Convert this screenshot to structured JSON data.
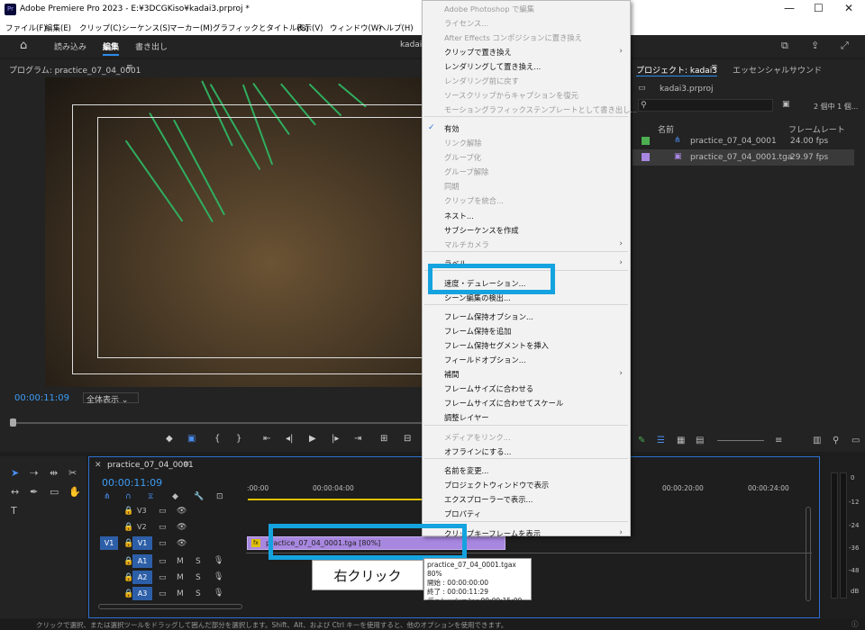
{
  "titlebar": {
    "title": "Adobe Premiere Pro 2023 - E:¥3DCGKiso¥kadai3.prproj *"
  },
  "menubar": {
    "items": [
      "ファイル(F)",
      "編集(E)",
      "クリップ(C)",
      "シーケンス(S)",
      "マーカー(M)",
      "グラフィックとタイトル(G)",
      "表示(V)",
      "ウィンドウ(W)",
      "ヘルプ(H)"
    ]
  },
  "workspaces": {
    "import": "読み込み",
    "edit": "編集",
    "export": "書き出し",
    "center": "kadai"
  },
  "program": {
    "header": "プログラム: practice_07_04_0001",
    "timecode": "00:00:11:09",
    "zoom": "全体表示"
  },
  "project": {
    "tab1": "プロジェクト: kadai3",
    "tab2": "エッセンシャルサウンド",
    "file": "kadai3.prproj",
    "count": "2 個中 1 個...",
    "col_name": "名前",
    "col_fps": "フレームレート",
    "rows": [
      {
        "name": "practice_07_04_0001",
        "fps": "24.00 fps",
        "color": "#4caf50"
      },
      {
        "name": "practice_07_04_0001.tga",
        "fps": "29.97 fps",
        "color": "#a887e0"
      }
    ]
  },
  "timeline": {
    "tab": "practice_07_04_0001",
    "timecode": "00:00:11:09",
    "ruler": [
      ":00:00",
      "00:00:04:00",
      "00:00:20:00",
      "00:00:24:00"
    ],
    "tracks": [
      "V3",
      "V2",
      "V1",
      "A1",
      "A2",
      "A3"
    ],
    "src": "V1",
    "clip": "practice_07_04_0001.tga [80%]"
  },
  "meter": {
    "labels": [
      "0",
      "-12",
      "-24",
      "-36",
      "-48",
      "dB"
    ]
  },
  "context_menu": {
    "items": [
      {
        "label": "Adobe Photoshop で編集",
        "dis": true
      },
      {
        "label": "ライセンス...",
        "dis": true
      },
      {
        "label": "After Effects コンポジションに置き換え",
        "dis": true
      },
      {
        "label": "クリップで置き換え",
        "dis": false,
        "arrow": true
      },
      {
        "label": "レンダリングして置き換え...",
        "dis": false
      },
      {
        "label": "レンダリング前に戻す",
        "dis": true
      },
      {
        "label": "ソースクリップからキャプションを復元",
        "dis": true
      },
      {
        "label": "モーショングラフィックステンプレートとして書き出し...",
        "dis": true,
        "sep": true
      },
      {
        "label": "有効",
        "dis": false,
        "check": true
      },
      {
        "label": "リンク解除",
        "dis": true
      },
      {
        "label": "グループ化",
        "dis": true
      },
      {
        "label": "グループ解除",
        "dis": true
      },
      {
        "label": "同期",
        "dis": true
      },
      {
        "label": "クリップを統合...",
        "dis": true
      },
      {
        "label": "ネスト...",
        "dis": false
      },
      {
        "label": "サブシーケンスを作成",
        "dis": false
      },
      {
        "label": "マルチカメラ",
        "dis": true,
        "arrow": true,
        "sep": true
      },
      {
        "label": "ラベル",
        "dis": false,
        "arrow": true,
        "sep": true
      },
      {
        "label": "速度・デュレーション...",
        "dis": false
      },
      {
        "label": "シーン編集の検出...",
        "dis": false,
        "sep": true
      },
      {
        "label": "フレーム保持オプション...",
        "dis": false
      },
      {
        "label": "フレーム保持を追加",
        "dis": false
      },
      {
        "label": "フレーム保持セグメントを挿入",
        "dis": false
      },
      {
        "label": "フィールドオプション...",
        "dis": false
      },
      {
        "label": "補間",
        "dis": false,
        "arrow": true
      },
      {
        "label": "フレームサイズに合わせる",
        "dis": false
      },
      {
        "label": "フレームサイズに合わせてスケール",
        "dis": false
      },
      {
        "label": "調整レイヤー",
        "dis": false,
        "sep": true
      },
      {
        "label": "メディアをリンク...",
        "dis": true
      },
      {
        "label": "オフラインにする...",
        "dis": false,
        "sep": true
      },
      {
        "label": "名前を変更...",
        "dis": false
      },
      {
        "label": "プロジェクトウィンドウで表示",
        "dis": false
      },
      {
        "label": "エクスプローラーで表示...",
        "dis": false
      },
      {
        "label": "プロパティ",
        "dis": false,
        "sep": true
      },
      {
        "label": "クリップキーフレームを表示",
        "dis": false,
        "arrow": true
      }
    ]
  },
  "callout": {
    "text": "右クリック"
  },
  "tooltip": {
    "lines": [
      "practice_07_04_0001.tgax 80%",
      "開始 : 00:00:00:00",
      "終了 : 00:00:11:29",
      "デュレーション : 00:00:15:00"
    ]
  },
  "status": {
    "text": "クリックで選択、または選択ツールをドラッグして囲んだ部分を選択します。Shift、Alt、および Ctrl キーを使用すると、他のオプションを使用できます。"
  }
}
